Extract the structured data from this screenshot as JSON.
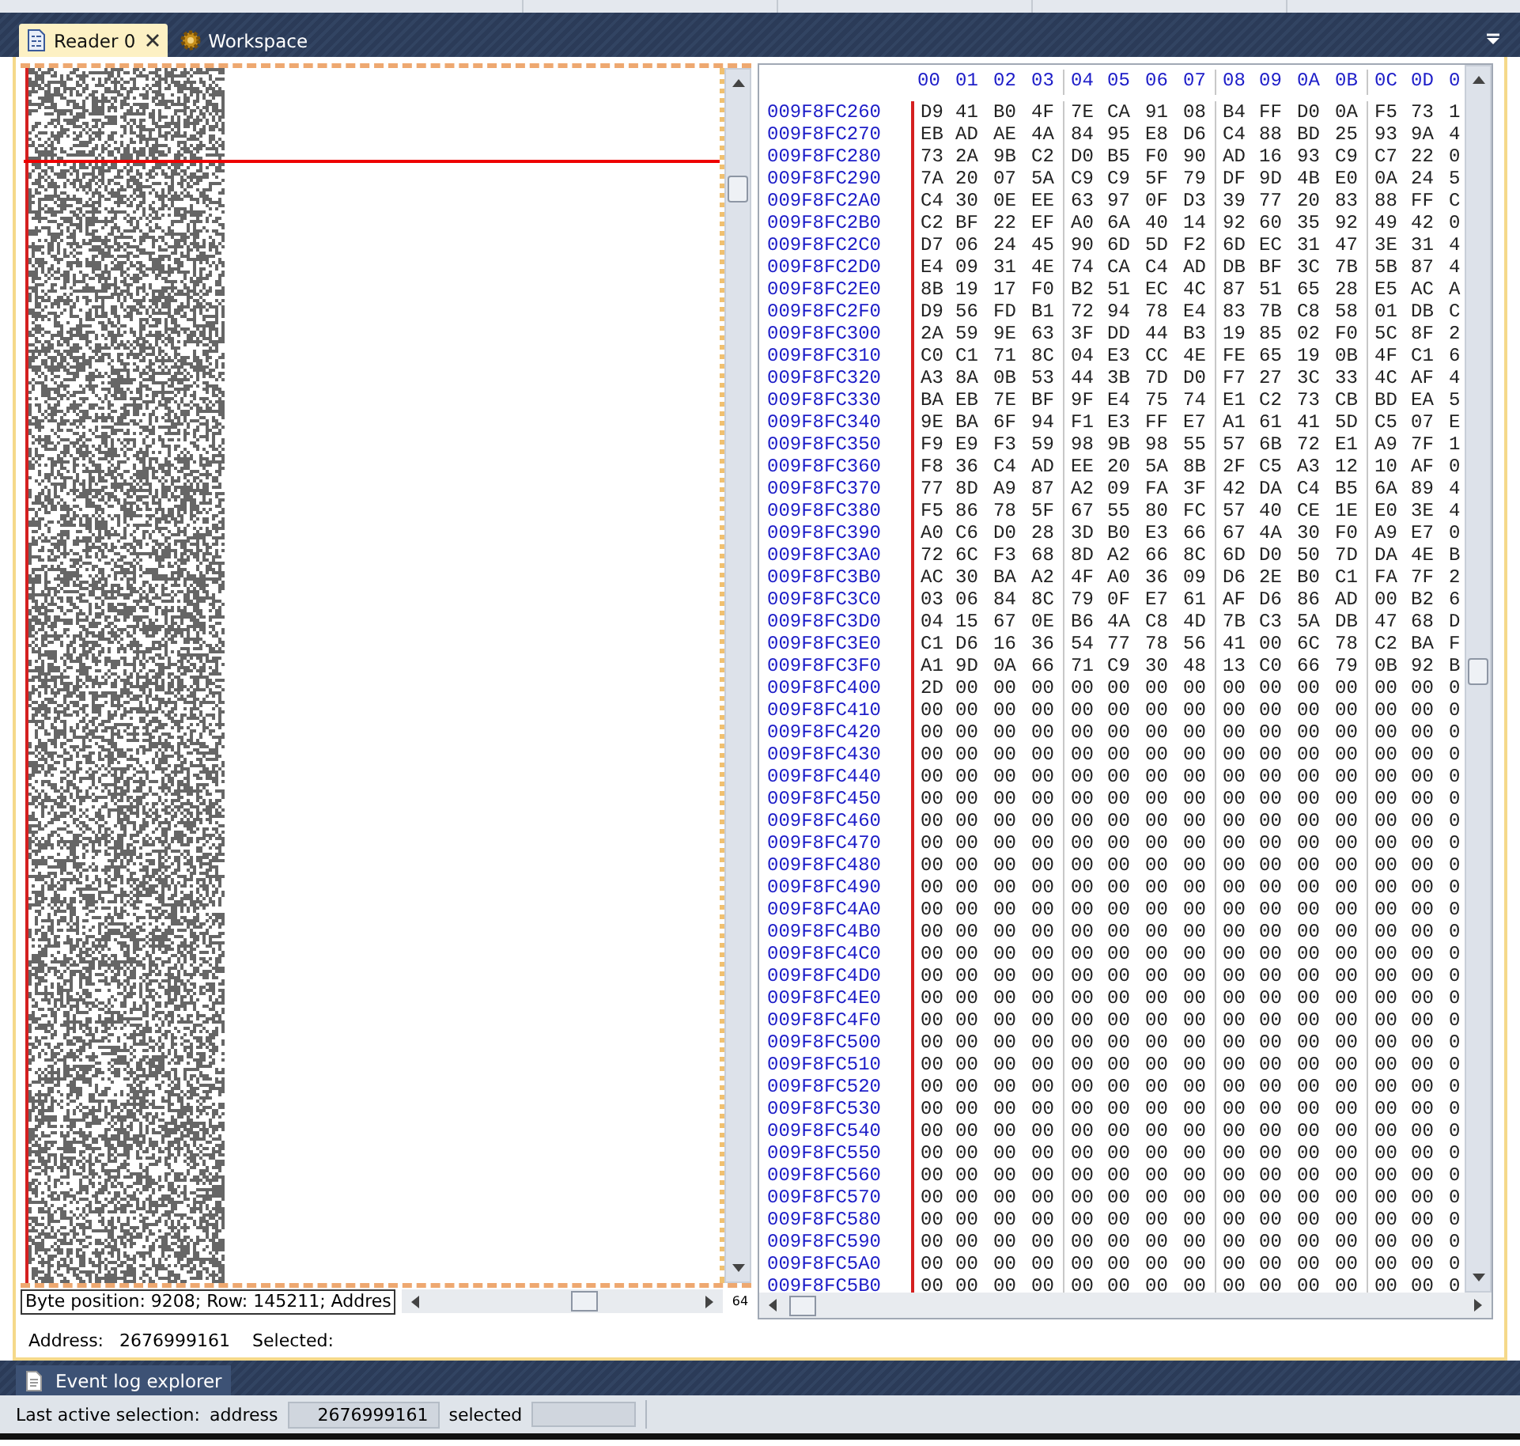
{
  "tabs": [
    {
      "label": "Reader 0",
      "selected": true,
      "kind": "reader"
    },
    {
      "label": "Workspace",
      "selected": false,
      "kind": "workspace"
    }
  ],
  "reader": {
    "status_text": "Byte position: 9208; Row: 145211; Addres",
    "zoom_label": "64",
    "hex": {
      "columns": [
        "00",
        "01",
        "02",
        "03",
        "04",
        "05",
        "06",
        "07",
        "08",
        "09",
        "0A",
        "0B",
        "0C",
        "0D",
        "0"
      ],
      "rows": [
        {
          "address": "009F8FC260",
          "bytes": [
            "D9",
            "41",
            "B0",
            "4F",
            "7E",
            "CA",
            "91",
            "08",
            "B4",
            "FF",
            "D0",
            "0A",
            "F5",
            "73",
            "1"
          ]
        },
        {
          "address": "009F8FC270",
          "bytes": [
            "EB",
            "AD",
            "AE",
            "4A",
            "84",
            "95",
            "E8",
            "D6",
            "C4",
            "88",
            "BD",
            "25",
            "93",
            "9A",
            "4"
          ]
        },
        {
          "address": "009F8FC280",
          "bytes": [
            "73",
            "2A",
            "9B",
            "C2",
            "D0",
            "B5",
            "F0",
            "90",
            "AD",
            "16",
            "93",
            "C9",
            "C7",
            "22",
            "0"
          ]
        },
        {
          "address": "009F8FC290",
          "bytes": [
            "7A",
            "20",
            "07",
            "5A",
            "C9",
            "C9",
            "5F",
            "79",
            "DF",
            "9D",
            "4B",
            "E0",
            "0A",
            "24",
            "5"
          ]
        },
        {
          "address": "009F8FC2A0",
          "bytes": [
            "C4",
            "30",
            "0E",
            "EE",
            "63",
            "97",
            "0F",
            "D3",
            "39",
            "77",
            "20",
            "83",
            "88",
            "FF",
            "C"
          ]
        },
        {
          "address": "009F8FC2B0",
          "bytes": [
            "C2",
            "BF",
            "22",
            "EF",
            "A0",
            "6A",
            "40",
            "14",
            "92",
            "60",
            "35",
            "92",
            "49",
            "42",
            "0"
          ]
        },
        {
          "address": "009F8FC2C0",
          "bytes": [
            "D7",
            "06",
            "24",
            "45",
            "90",
            "6D",
            "5D",
            "F2",
            "6D",
            "EC",
            "31",
            "47",
            "3E",
            "31",
            "4"
          ]
        },
        {
          "address": "009F8FC2D0",
          "bytes": [
            "E4",
            "09",
            "31",
            "4E",
            "74",
            "CA",
            "C4",
            "AD",
            "DB",
            "BF",
            "3C",
            "7B",
            "5B",
            "87",
            "4"
          ]
        },
        {
          "address": "009F8FC2E0",
          "bytes": [
            "8B",
            "19",
            "17",
            "F0",
            "B2",
            "51",
            "EC",
            "4C",
            "87",
            "51",
            "65",
            "28",
            "E5",
            "AC",
            "A"
          ]
        },
        {
          "address": "009F8FC2F0",
          "bytes": [
            "D9",
            "56",
            "FD",
            "B1",
            "72",
            "94",
            "78",
            "E4",
            "83",
            "7B",
            "C8",
            "58",
            "01",
            "DB",
            "C"
          ]
        },
        {
          "address": "009F8FC300",
          "bytes": [
            "2A",
            "59",
            "9E",
            "63",
            "3F",
            "DD",
            "44",
            "B3",
            "19",
            "85",
            "02",
            "F0",
            "5C",
            "8F",
            "2"
          ]
        },
        {
          "address": "009F8FC310",
          "bytes": [
            "C0",
            "C1",
            "71",
            "8C",
            "04",
            "E3",
            "CC",
            "4E",
            "FE",
            "65",
            "19",
            "0B",
            "4F",
            "C1",
            "6"
          ]
        },
        {
          "address": "009F8FC320",
          "bytes": [
            "A3",
            "8A",
            "0B",
            "53",
            "44",
            "3B",
            "7D",
            "D0",
            "F7",
            "27",
            "3C",
            "33",
            "4C",
            "AF",
            "4"
          ]
        },
        {
          "address": "009F8FC330",
          "bytes": [
            "BA",
            "EB",
            "7E",
            "BF",
            "9F",
            "E4",
            "75",
            "74",
            "E1",
            "C2",
            "73",
            "CB",
            "BD",
            "EA",
            "5"
          ]
        },
        {
          "address": "009F8FC340",
          "bytes": [
            "9E",
            "BA",
            "6F",
            "94",
            "F1",
            "E3",
            "FF",
            "E7",
            "A1",
            "61",
            "41",
            "5D",
            "C5",
            "07",
            "E"
          ]
        },
        {
          "address": "009F8FC350",
          "bytes": [
            "F9",
            "E9",
            "F3",
            "59",
            "98",
            "9B",
            "98",
            "55",
            "57",
            "6B",
            "72",
            "E1",
            "A9",
            "7F",
            "1"
          ]
        },
        {
          "address": "009F8FC360",
          "bytes": [
            "F8",
            "36",
            "C4",
            "AD",
            "EE",
            "20",
            "5A",
            "8B",
            "2F",
            "C5",
            "A3",
            "12",
            "10",
            "AF",
            "0"
          ]
        },
        {
          "address": "009F8FC370",
          "bytes": [
            "77",
            "8D",
            "A9",
            "87",
            "A2",
            "09",
            "FA",
            "3F",
            "42",
            "DA",
            "C4",
            "B5",
            "6A",
            "89",
            "4"
          ]
        },
        {
          "address": "009F8FC380",
          "bytes": [
            "F5",
            "86",
            "78",
            "5F",
            "67",
            "55",
            "80",
            "FC",
            "57",
            "40",
            "CE",
            "1E",
            "E0",
            "3E",
            "4"
          ]
        },
        {
          "address": "009F8FC390",
          "bytes": [
            "A0",
            "C6",
            "D0",
            "28",
            "3D",
            "B0",
            "E3",
            "66",
            "67",
            "4A",
            "30",
            "F0",
            "A9",
            "E7",
            "0"
          ]
        },
        {
          "address": "009F8FC3A0",
          "bytes": [
            "72",
            "6C",
            "F3",
            "68",
            "8D",
            "A2",
            "66",
            "8C",
            "6D",
            "D0",
            "50",
            "7D",
            "DA",
            "4E",
            "B"
          ]
        },
        {
          "address": "009F8FC3B0",
          "bytes": [
            "AC",
            "30",
            "BA",
            "A2",
            "4F",
            "A0",
            "36",
            "09",
            "D6",
            "2E",
            "B0",
            "C1",
            "FA",
            "7F",
            "2"
          ]
        },
        {
          "address": "009F8FC3C0",
          "bytes": [
            "03",
            "06",
            "84",
            "8C",
            "79",
            "0F",
            "E7",
            "61",
            "AF",
            "D6",
            "86",
            "AD",
            "00",
            "B2",
            "6"
          ]
        },
        {
          "address": "009F8FC3D0",
          "bytes": [
            "04",
            "15",
            "67",
            "0E",
            "B6",
            "4A",
            "C8",
            "4D",
            "7B",
            "C3",
            "5A",
            "DB",
            "47",
            "68",
            "D"
          ]
        },
        {
          "address": "009F8FC3E0",
          "bytes": [
            "C1",
            "D6",
            "16",
            "36",
            "54",
            "77",
            "78",
            "56",
            "41",
            "00",
            "6C",
            "78",
            "C2",
            "BA",
            "F"
          ]
        },
        {
          "address": "009F8FC3F0",
          "bytes": [
            "A1",
            "9D",
            "0A",
            "66",
            "71",
            "C9",
            "30",
            "48",
            "13",
            "C0",
            "66",
            "79",
            "0B",
            "92",
            "B"
          ]
        },
        {
          "address": "009F8FC400",
          "bytes": [
            "2D",
            "00",
            "00",
            "00",
            "00",
            "00",
            "00",
            "00",
            "00",
            "00",
            "00",
            "00",
            "00",
            "00",
            "0"
          ]
        },
        {
          "address": "009F8FC410",
          "bytes": [
            "00",
            "00",
            "00",
            "00",
            "00",
            "00",
            "00",
            "00",
            "00",
            "00",
            "00",
            "00",
            "00",
            "00",
            "0"
          ]
        },
        {
          "address": "009F8FC420",
          "bytes": [
            "00",
            "00",
            "00",
            "00",
            "00",
            "00",
            "00",
            "00",
            "00",
            "00",
            "00",
            "00",
            "00",
            "00",
            "0"
          ]
        },
        {
          "address": "009F8FC430",
          "bytes": [
            "00",
            "00",
            "00",
            "00",
            "00",
            "00",
            "00",
            "00",
            "00",
            "00",
            "00",
            "00",
            "00",
            "00",
            "0"
          ]
        },
        {
          "address": "009F8FC440",
          "bytes": [
            "00",
            "00",
            "00",
            "00",
            "00",
            "00",
            "00",
            "00",
            "00",
            "00",
            "00",
            "00",
            "00",
            "00",
            "0"
          ]
        },
        {
          "address": "009F8FC450",
          "bytes": [
            "00",
            "00",
            "00",
            "00",
            "00",
            "00",
            "00",
            "00",
            "00",
            "00",
            "00",
            "00",
            "00",
            "00",
            "0"
          ]
        },
        {
          "address": "009F8FC460",
          "bytes": [
            "00",
            "00",
            "00",
            "00",
            "00",
            "00",
            "00",
            "00",
            "00",
            "00",
            "00",
            "00",
            "00",
            "00",
            "0"
          ]
        },
        {
          "address": "009F8FC470",
          "bytes": [
            "00",
            "00",
            "00",
            "00",
            "00",
            "00",
            "00",
            "00",
            "00",
            "00",
            "00",
            "00",
            "00",
            "00",
            "0"
          ]
        },
        {
          "address": "009F8FC480",
          "bytes": [
            "00",
            "00",
            "00",
            "00",
            "00",
            "00",
            "00",
            "00",
            "00",
            "00",
            "00",
            "00",
            "00",
            "00",
            "0"
          ]
        },
        {
          "address": "009F8FC490",
          "bytes": [
            "00",
            "00",
            "00",
            "00",
            "00",
            "00",
            "00",
            "00",
            "00",
            "00",
            "00",
            "00",
            "00",
            "00",
            "0"
          ]
        },
        {
          "address": "009F8FC4A0",
          "bytes": [
            "00",
            "00",
            "00",
            "00",
            "00",
            "00",
            "00",
            "00",
            "00",
            "00",
            "00",
            "00",
            "00",
            "00",
            "0"
          ]
        },
        {
          "address": "009F8FC4B0",
          "bytes": [
            "00",
            "00",
            "00",
            "00",
            "00",
            "00",
            "00",
            "00",
            "00",
            "00",
            "00",
            "00",
            "00",
            "00",
            "0"
          ]
        },
        {
          "address": "009F8FC4C0",
          "bytes": [
            "00",
            "00",
            "00",
            "00",
            "00",
            "00",
            "00",
            "00",
            "00",
            "00",
            "00",
            "00",
            "00",
            "00",
            "0"
          ]
        },
        {
          "address": "009F8FC4D0",
          "bytes": [
            "00",
            "00",
            "00",
            "00",
            "00",
            "00",
            "00",
            "00",
            "00",
            "00",
            "00",
            "00",
            "00",
            "00",
            "0"
          ]
        },
        {
          "address": "009F8FC4E0",
          "bytes": [
            "00",
            "00",
            "00",
            "00",
            "00",
            "00",
            "00",
            "00",
            "00",
            "00",
            "00",
            "00",
            "00",
            "00",
            "0"
          ]
        },
        {
          "address": "009F8FC4F0",
          "bytes": [
            "00",
            "00",
            "00",
            "00",
            "00",
            "00",
            "00",
            "00",
            "00",
            "00",
            "00",
            "00",
            "00",
            "00",
            "0"
          ]
        },
        {
          "address": "009F8FC500",
          "bytes": [
            "00",
            "00",
            "00",
            "00",
            "00",
            "00",
            "00",
            "00",
            "00",
            "00",
            "00",
            "00",
            "00",
            "00",
            "0"
          ]
        },
        {
          "address": "009F8FC510",
          "bytes": [
            "00",
            "00",
            "00",
            "00",
            "00",
            "00",
            "00",
            "00",
            "00",
            "00",
            "00",
            "00",
            "00",
            "00",
            "0"
          ]
        },
        {
          "address": "009F8FC520",
          "bytes": [
            "00",
            "00",
            "00",
            "00",
            "00",
            "00",
            "00",
            "00",
            "00",
            "00",
            "00",
            "00",
            "00",
            "00",
            "0"
          ]
        },
        {
          "address": "009F8FC530",
          "bytes": [
            "00",
            "00",
            "00",
            "00",
            "00",
            "00",
            "00",
            "00",
            "00",
            "00",
            "00",
            "00",
            "00",
            "00",
            "0"
          ]
        },
        {
          "address": "009F8FC540",
          "bytes": [
            "00",
            "00",
            "00",
            "00",
            "00",
            "00",
            "00",
            "00",
            "00",
            "00",
            "00",
            "00",
            "00",
            "00",
            "0"
          ]
        },
        {
          "address": "009F8FC550",
          "bytes": [
            "00",
            "00",
            "00",
            "00",
            "00",
            "00",
            "00",
            "00",
            "00",
            "00",
            "00",
            "00",
            "00",
            "00",
            "0"
          ]
        },
        {
          "address": "009F8FC560",
          "bytes": [
            "00",
            "00",
            "00",
            "00",
            "00",
            "00",
            "00",
            "00",
            "00",
            "00",
            "00",
            "00",
            "00",
            "00",
            "0"
          ]
        },
        {
          "address": "009F8FC570",
          "bytes": [
            "00",
            "00",
            "00",
            "00",
            "00",
            "00",
            "00",
            "00",
            "00",
            "00",
            "00",
            "00",
            "00",
            "00",
            "0"
          ]
        },
        {
          "address": "009F8FC580",
          "bytes": [
            "00",
            "00",
            "00",
            "00",
            "00",
            "00",
            "00",
            "00",
            "00",
            "00",
            "00",
            "00",
            "00",
            "00",
            "0"
          ]
        },
        {
          "address": "009F8FC590",
          "bytes": [
            "00",
            "00",
            "00",
            "00",
            "00",
            "00",
            "00",
            "00",
            "00",
            "00",
            "00",
            "00",
            "00",
            "00",
            "0"
          ]
        },
        {
          "address": "009F8FC5A0",
          "bytes": [
            "00",
            "00",
            "00",
            "00",
            "00",
            "00",
            "00",
            "00",
            "00",
            "00",
            "00",
            "00",
            "00",
            "00",
            "0"
          ]
        },
        {
          "address": "009F8FC5B0",
          "bytes": [
            "00",
            "00",
            "00",
            "00",
            "00",
            "00",
            "00",
            "00",
            "00",
            "00",
            "00",
            "00",
            "00",
            "00",
            "0"
          ]
        }
      ]
    },
    "info": {
      "address_label": "Address:",
      "address_value": "2676999161",
      "selected_label": "Selected:"
    }
  },
  "bottom_tabs": [
    {
      "label": "Event log explorer"
    }
  ],
  "status_bar": {
    "label": "Last active selection:",
    "address_label": "address",
    "address_value": "2676999161",
    "selected_label": "selected"
  }
}
